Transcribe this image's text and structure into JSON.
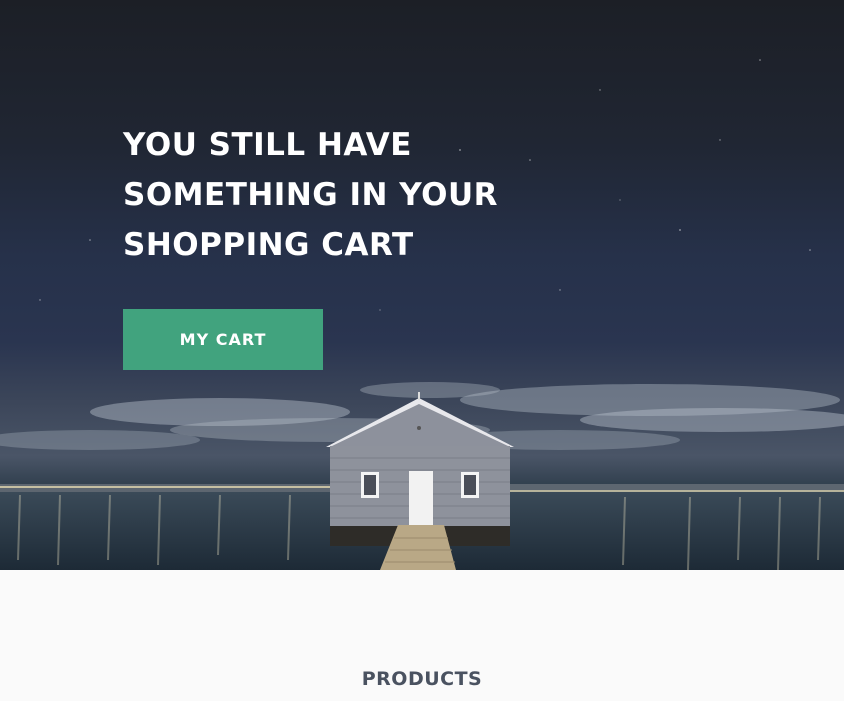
{
  "hero": {
    "headline": "YOU STILL HAVE SOMETHING IN YOUR SHOPPING CART",
    "button_label": "MY CART",
    "button_color": "#41a37e",
    "background_image": "night-lake-boathouse-photo"
  },
  "products": {
    "title": "PRODUCTS"
  }
}
